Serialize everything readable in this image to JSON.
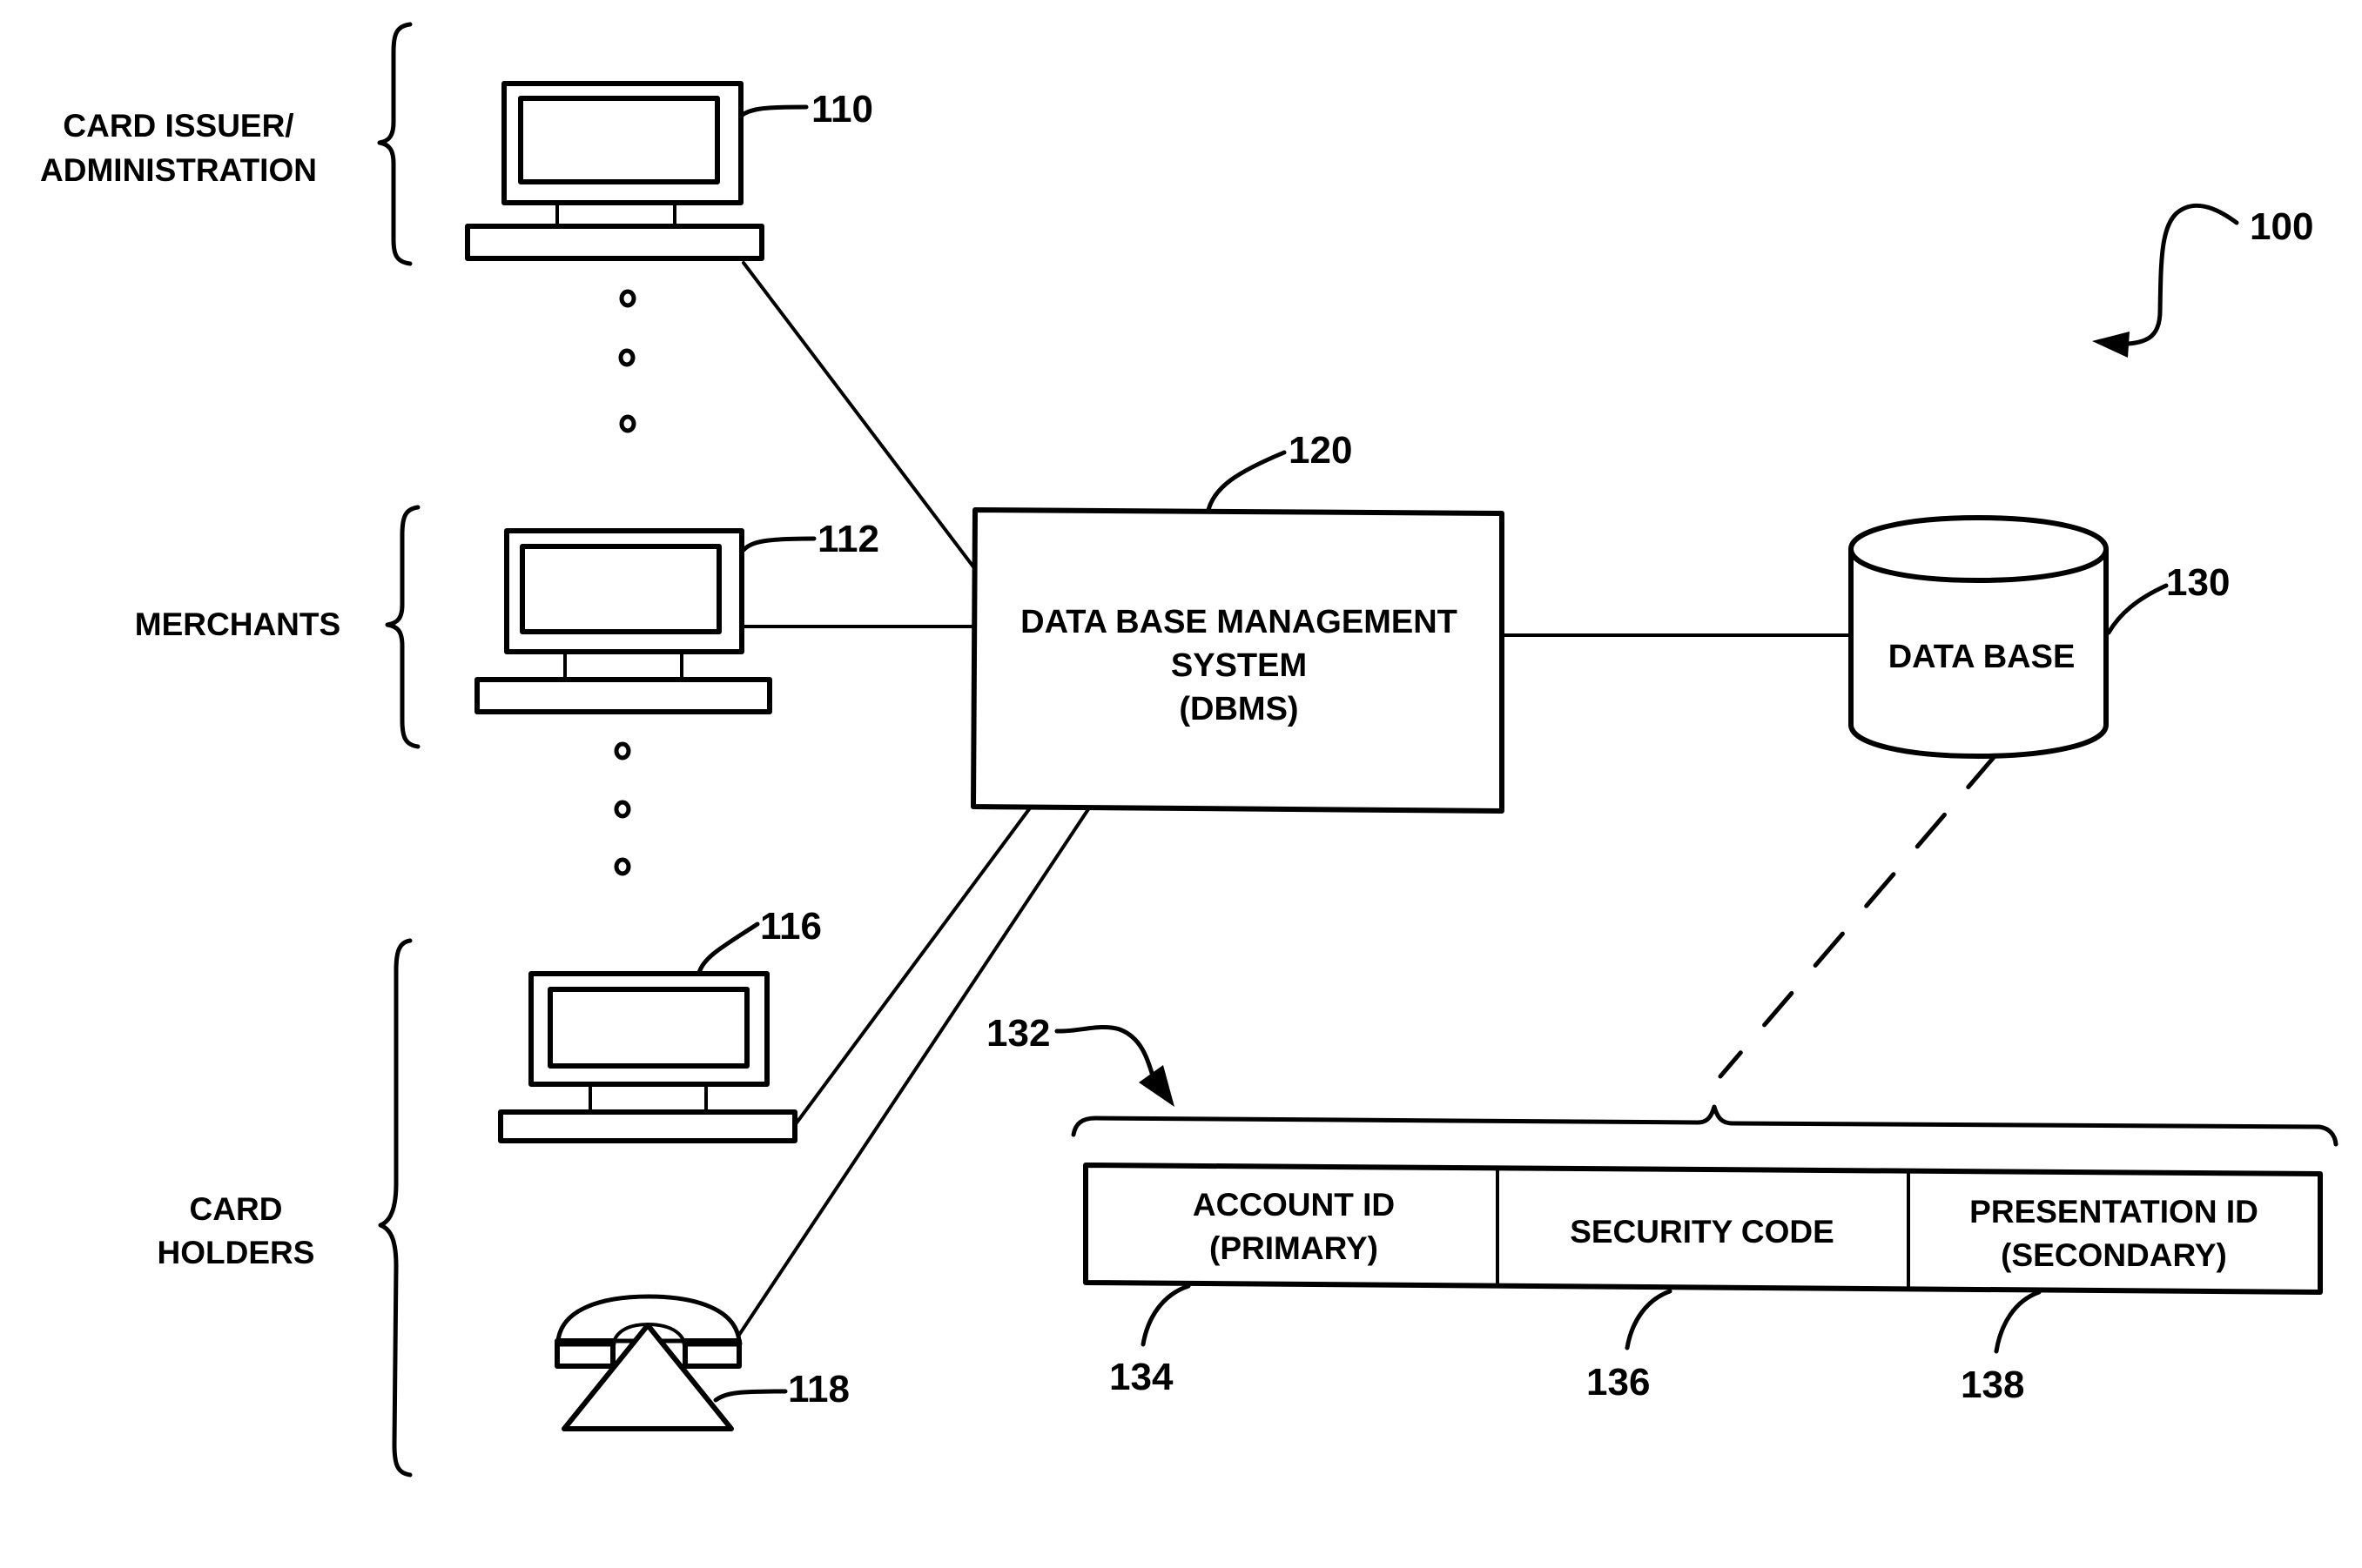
{
  "figure": {
    "reference_number": "100",
    "groups": [
      {
        "id": "card-issuer",
        "lines": [
          "CARD ISSUER/",
          "ADMINISTRATION"
        ]
      },
      {
        "id": "merchants",
        "lines": [
          "MERCHANTS"
        ]
      },
      {
        "id": "card-holders",
        "lines": [
          "CARD",
          "HOLDERS"
        ]
      }
    ],
    "devices": [
      {
        "id": "terminal-110",
        "type": "computer",
        "ref": "110",
        "group": "card-issuer"
      },
      {
        "id": "terminal-112",
        "type": "computer",
        "ref": "112",
        "group": "merchants"
      },
      {
        "id": "terminal-116",
        "type": "computer",
        "ref": "116",
        "group": "card-holders"
      },
      {
        "id": "telephone-118",
        "type": "telephone",
        "ref": "118",
        "group": "card-holders"
      }
    ],
    "dbms": {
      "ref": "120",
      "lines": [
        "DATA BASE MANAGEMENT",
        "SYSTEM",
        "(DBMS)"
      ]
    },
    "database": {
      "ref": "130",
      "label": "DATA BASE"
    },
    "record": {
      "ref": "132",
      "fields": [
        {
          "ref": "134",
          "lines": [
            "ACCOUNT ID",
            "(PRIMARY)"
          ]
        },
        {
          "ref": "136",
          "lines": [
            "SECURITY CODE"
          ]
        },
        {
          "ref": "138",
          "lines": [
            "PRESENTATION ID",
            "(SECONDARY)"
          ]
        }
      ]
    },
    "connections": [
      {
        "from": "terminal-110",
        "to": "dbms",
        "style": "solid"
      },
      {
        "from": "terminal-112",
        "to": "dbms",
        "style": "solid"
      },
      {
        "from": "terminal-116",
        "to": "dbms",
        "style": "solid"
      },
      {
        "from": "telephone-118",
        "to": "dbms",
        "style": "solid"
      },
      {
        "from": "dbms",
        "to": "database",
        "style": "solid"
      },
      {
        "from": "database",
        "to": "record",
        "style": "dashed"
      }
    ],
    "ellipsis_glyph": "o"
  }
}
